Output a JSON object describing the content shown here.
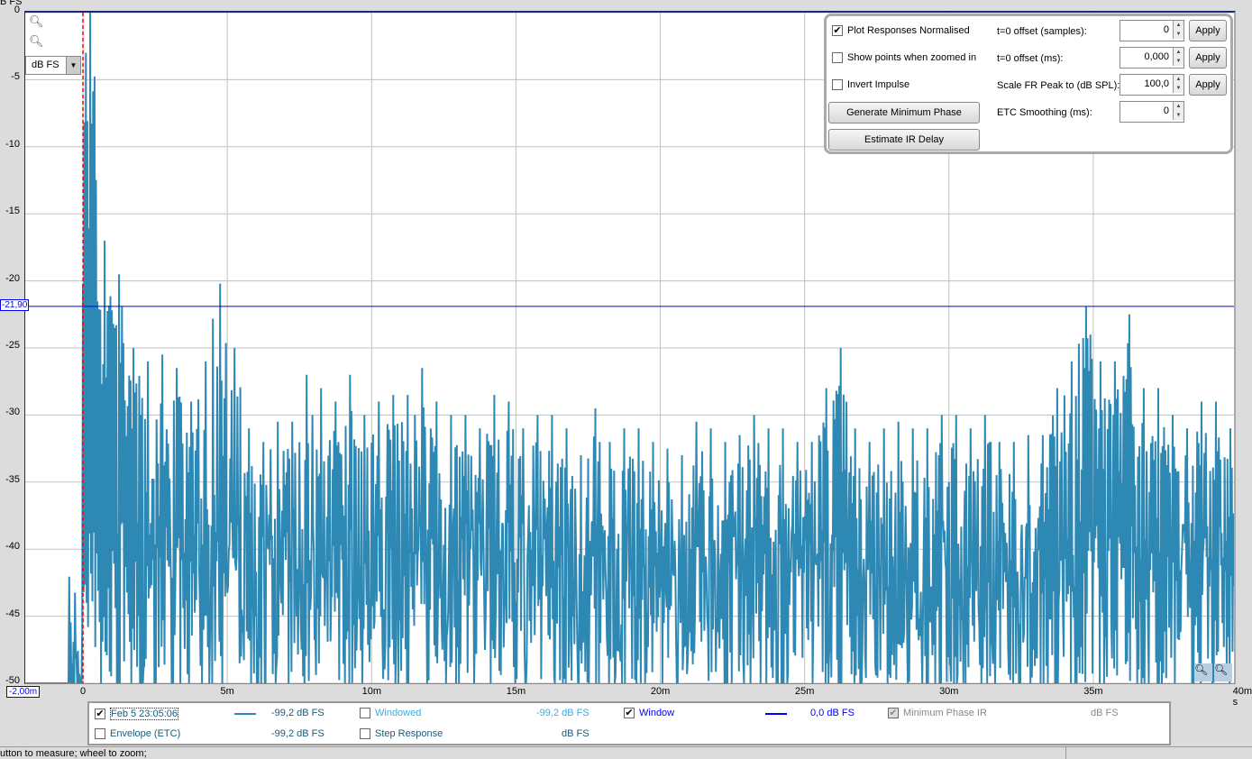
{
  "axis": {
    "y_unit": "B FS",
    "unit_selector": "dB FS",
    "cursor_y": "-21,90",
    "cursor_x": "-2,00m"
  },
  "chart_data": {
    "type": "line",
    "ylabel": "dB FS",
    "xlabel": "s",
    "xlim": [
      -2,
      40
    ],
    "ylim": [
      -50,
      0
    ],
    "grid": true,
    "y_ticks": [
      "0",
      "-5",
      "-10",
      "-15",
      "-20",
      "-25",
      "-30",
      "-35",
      "-40",
      "-45",
      "-50"
    ],
    "x_ticks": [
      "0",
      "5m",
      "10m",
      "15m",
      "20m",
      "25m",
      "30m",
      "35m",
      "40m s"
    ],
    "x_tick_values": [
      0,
      5,
      10,
      15,
      20,
      25,
      30,
      35,
      40
    ],
    "x_unit": "ms",
    "series": [
      {
        "name": "Feb 5 23:05:06",
        "color": "#2e88b4",
        "x_step_ms": 0.5,
        "x_start_ms": -2,
        "values": [
          -50,
          -50,
          -50,
          -48,
          0,
          -17,
          -19.5,
          -25,
          -26,
          -25.5,
          -26.5,
          -29,
          -26,
          -20.2,
          -25,
          -31,
          -32,
          -30.5,
          -30.5,
          -27,
          -28,
          -29,
          -27,
          -30,
          -29,
          -28.5,
          -28.5,
          -26.5,
          -29,
          -30,
          -30,
          -31,
          -28.5,
          -29,
          -31,
          -30,
          -30,
          -31,
          -33,
          -29.5,
          -32,
          -31,
          -31,
          -32,
          -32.5,
          -33,
          -30.5,
          -31,
          -32,
          -31.5,
          -30,
          -31,
          -31,
          -32,
          -32,
          -28,
          -25,
          -31,
          -32,
          -31,
          -30.5,
          -31,
          -31,
          -30,
          -30,
          -31,
          -30,
          -32,
          -32,
          -31.5,
          -31.5,
          -28,
          -26,
          -21.9,
          -26,
          -26,
          -22.5,
          -28,
          -28,
          -30,
          -31,
          -29,
          -29,
          -31,
          -34,
          -34.5
        ]
      }
    ],
    "markers": {
      "cursor_level_db": -21.9,
      "t0_ms": 0
    }
  },
  "colors": {
    "trace": "#2e88b4",
    "cursor": "#0000ff",
    "t0": "#ff0000"
  },
  "panel": {
    "plot_normalised": "Plot Responses Normalised",
    "plot_normalised_checked": true,
    "show_points": "Show points when zoomed in",
    "show_points_checked": false,
    "invert": "Invert Impulse",
    "invert_checked": false,
    "gen_min_phase": "Generate Minimum Phase",
    "estimate_delay": "Estimate IR Delay",
    "offset_samples_label": "t=0 offset (samples):",
    "offset_samples": "0",
    "offset_ms_label": "t=0 offset (ms):",
    "offset_ms": "0,000",
    "scale_label": "Scale FR Peak to (dB SPL):",
    "scale": "100,0",
    "etc_label": "ETC Smoothing (ms):",
    "etc": "0",
    "apply": "Apply"
  },
  "legend": [
    {
      "label": "Feb 5 23:05:06",
      "value": "-99,2 dB FS",
      "checked": true,
      "color": "#1a5a7a",
      "line": "#2e88b4"
    },
    {
      "label": "Windowed",
      "value": "-99,2 dB FS",
      "checked": false,
      "color": "#3aaee0"
    },
    {
      "label": "Window",
      "value": "0,0 dB FS",
      "checked": true,
      "color": "#0000ff",
      "line": "#0000ff"
    },
    {
      "label": "Minimum Phase IR",
      "value": "dB FS",
      "checked": true,
      "disabled": true,
      "color": "#888"
    },
    {
      "label": "Envelope (ETC)",
      "value": "-99,2 dB FS",
      "checked": false,
      "color": "#1a5a7a"
    },
    {
      "label": "Step Response",
      "value": "dB FS",
      "checked": false,
      "color": "#1a5a7a"
    }
  ],
  "status": "utton to measure; wheel to zoom;"
}
